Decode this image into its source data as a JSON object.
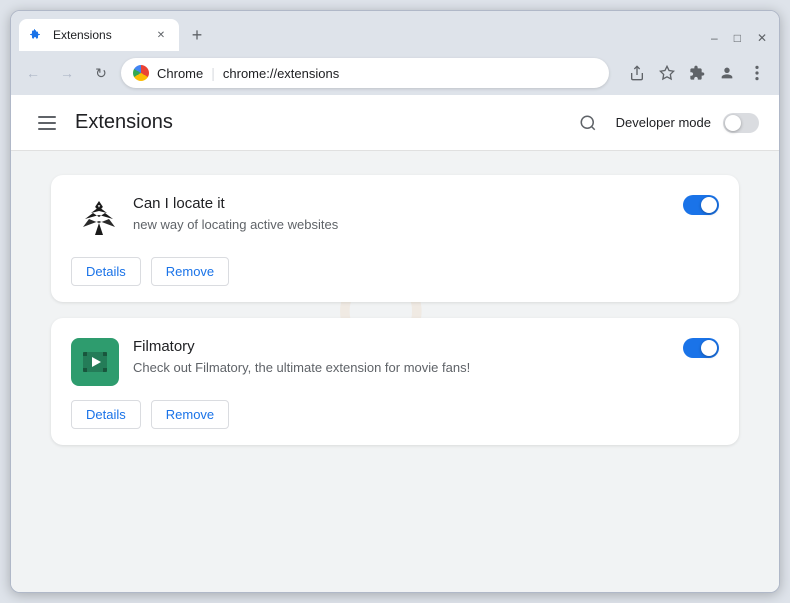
{
  "browser": {
    "tab_title": "Extensions",
    "tab_favicon": "puzzle-icon",
    "url_protocol": "chrome://",
    "url_path": "extensions",
    "url_display": "chrome://extensions",
    "chrome_label": "Chrome"
  },
  "header": {
    "title": "Extensions",
    "search_label": "search",
    "developer_mode_label": "Developer mode",
    "developer_mode_on": false
  },
  "extensions": [
    {
      "id": "ext1",
      "name": "Can I locate it",
      "description": "new way of locating active websites",
      "icon_type": "falcon",
      "enabled": true,
      "details_label": "Details",
      "remove_label": "Remove"
    },
    {
      "id": "ext2",
      "name": "Filmatory",
      "description": "Check out Filmatory, the ultimate extension for movie fans!",
      "icon_type": "filmatory",
      "enabled": true,
      "details_label": "Details",
      "remove_label": "Remove"
    }
  ],
  "title_bar_controls": {
    "minimize": "–",
    "maximize": "□",
    "close": "✕"
  }
}
